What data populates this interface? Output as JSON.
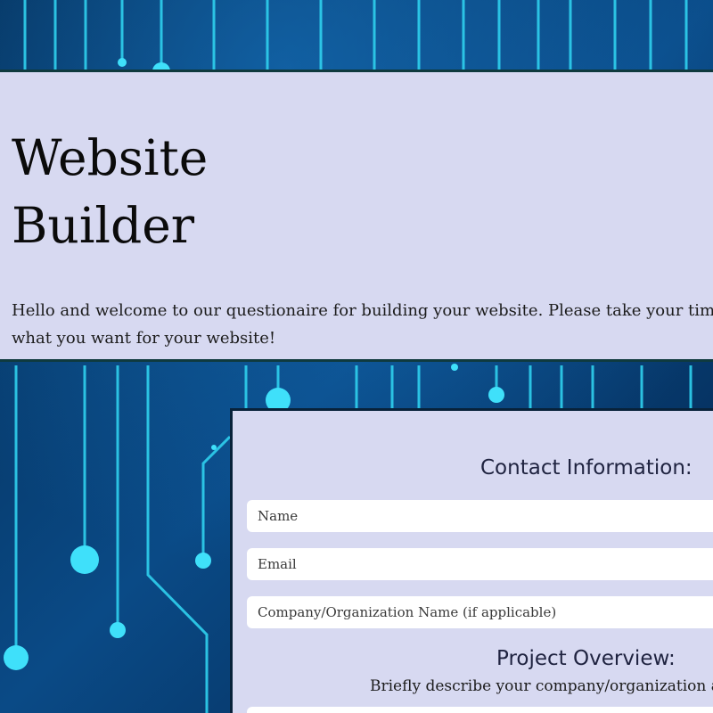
{
  "header": {
    "title": "Website Builder",
    "intro": "Hello and welcome to our questionaire for building your website. Please take your time a what you want for your website!"
  },
  "contact_section": {
    "heading": "Contact Information:",
    "fields": {
      "name_placeholder": "Name",
      "email_placeholder": "Email",
      "company_placeholder": "Company/Organization Name (if applicable)"
    }
  },
  "project_section": {
    "heading": "Project Overview:",
    "describe_label": "Briefly describe your company/organization and"
  },
  "theme": {
    "panel_color": "#d7d9f1",
    "background_color": "#04284e",
    "accent_color": "#33d6f2",
    "border_color": "#0f3a3e"
  },
  "background_icon": "circuit-board-pattern"
}
